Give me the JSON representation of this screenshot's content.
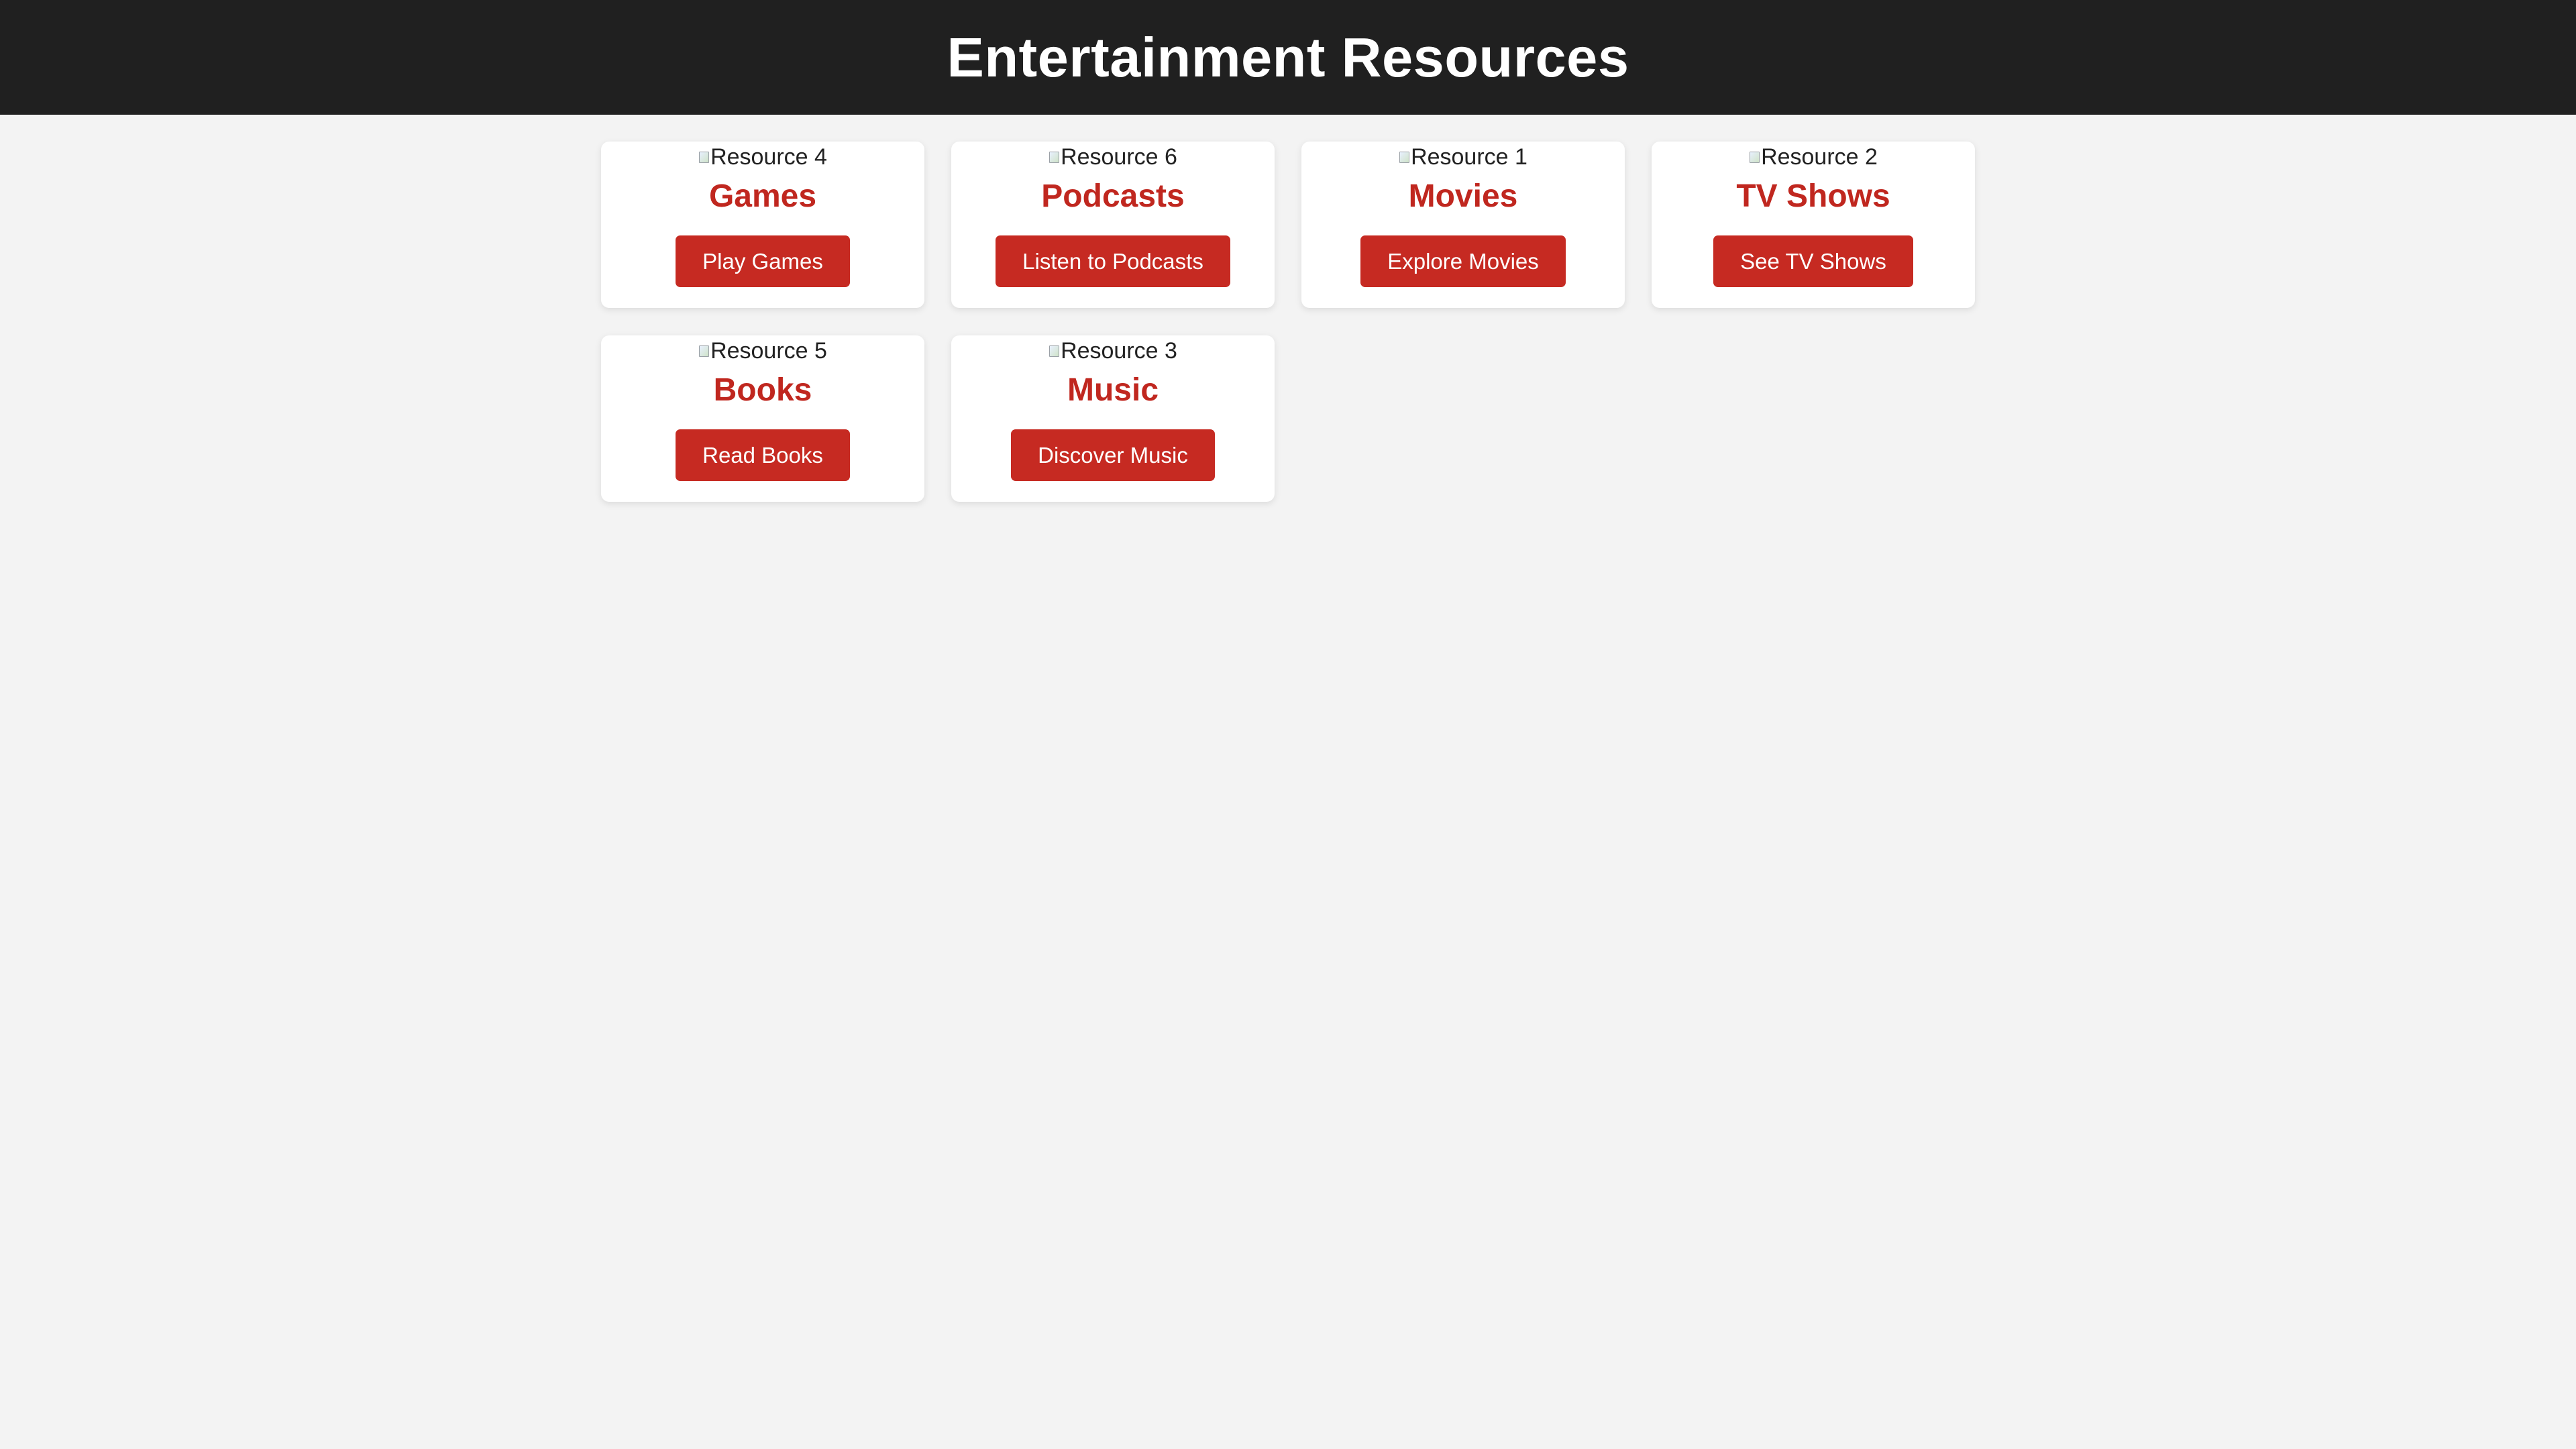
{
  "header": {
    "title": "Entertainment Resources"
  },
  "colors": {
    "header_bg": "#202020",
    "page_bg": "#f3f3f3",
    "accent": "#c62a22"
  },
  "cards": [
    {
      "img_alt": "Resource 4",
      "title": "Games",
      "button": "Play Games"
    },
    {
      "img_alt": "Resource 6",
      "title": "Podcasts",
      "button": "Listen to Podcasts"
    },
    {
      "img_alt": "Resource 1",
      "title": "Movies",
      "button": "Explore Movies"
    },
    {
      "img_alt": "Resource 2",
      "title": "TV Shows",
      "button": "See TV Shows"
    },
    {
      "img_alt": "Resource 5",
      "title": "Books",
      "button": "Read Books"
    },
    {
      "img_alt": "Resource 3",
      "title": "Music",
      "button": "Discover Music"
    }
  ]
}
